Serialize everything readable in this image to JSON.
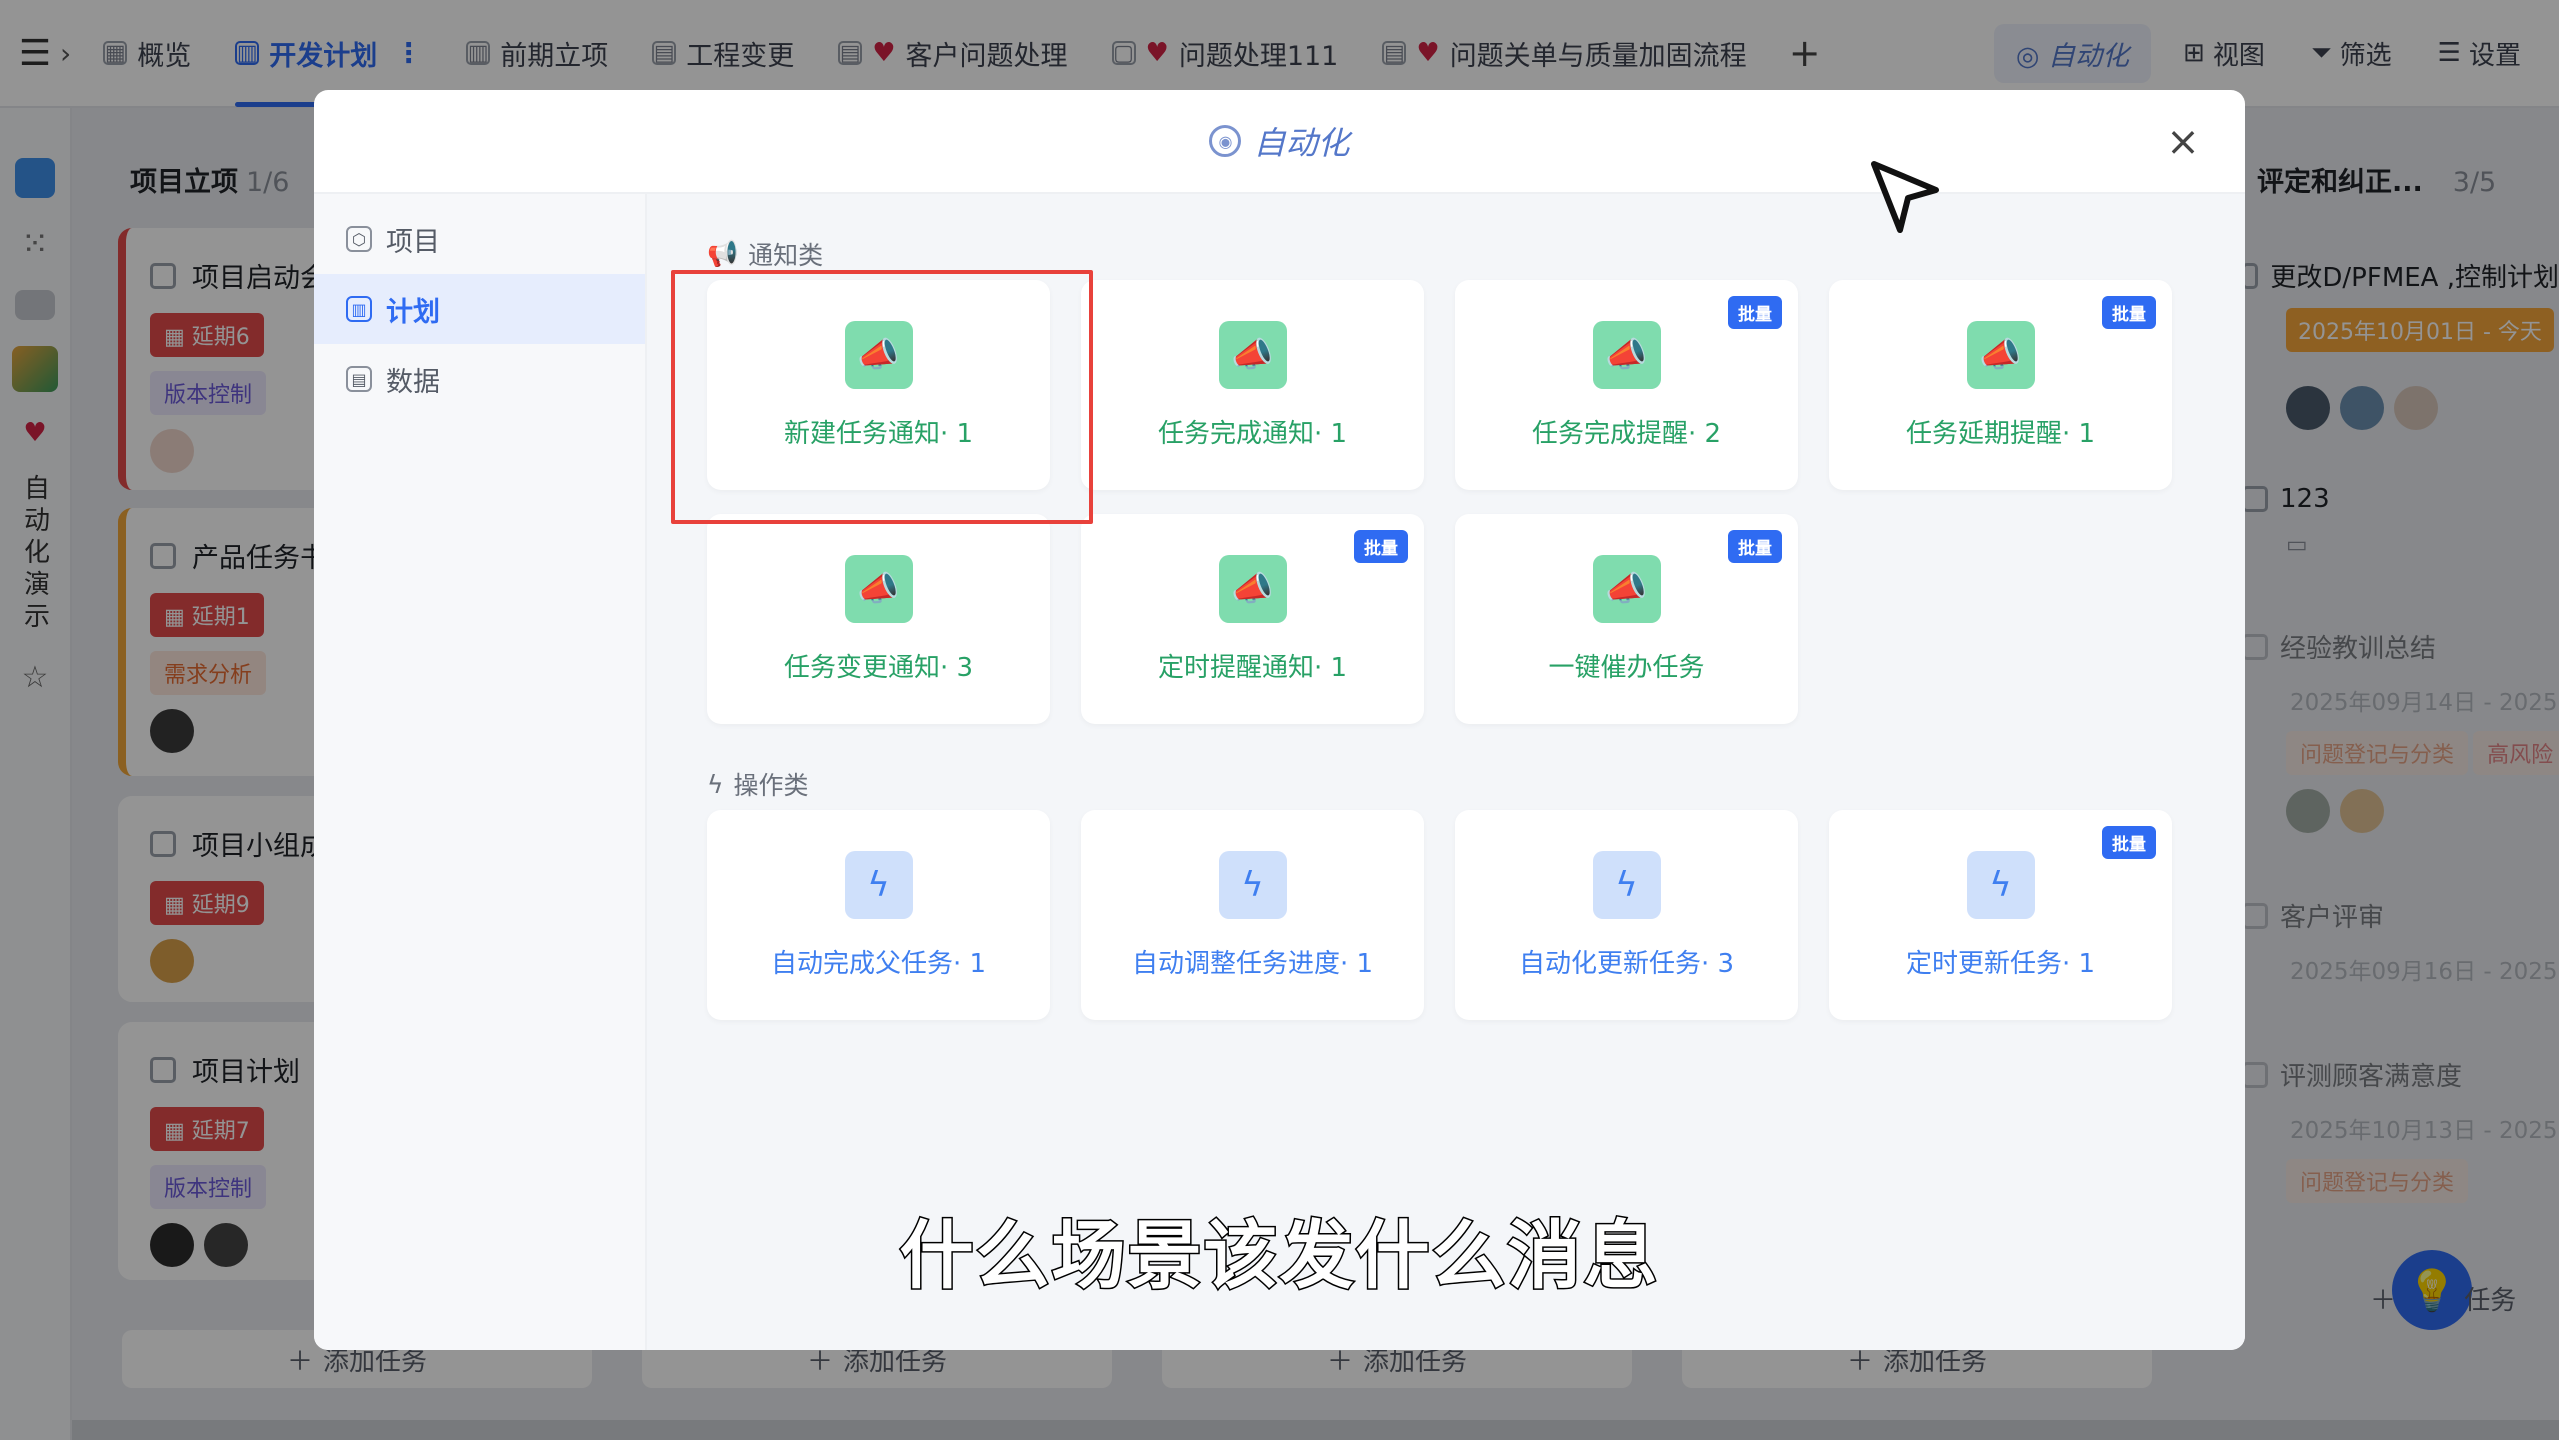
{
  "topbar": {
    "tabs": [
      {
        "label": "概览",
        "heart": false
      },
      {
        "label": "开发计划",
        "heart": false,
        "active": true
      },
      {
        "label": "前期立项",
        "heart": false
      },
      {
        "label": "工程变更",
        "heart": false
      },
      {
        "label": "客户问题处理",
        "heart": true
      },
      {
        "label": "问题处理111",
        "heart": true
      },
      {
        "label": "问题关单与质量加固流程",
        "heart": true
      }
    ],
    "more_glyph": "⋮",
    "add_tab": "+",
    "automation": "自动化",
    "view": "视图",
    "filter": "筛选",
    "settings": "设置"
  },
  "leftrail": {
    "vertical_label": "自动化演示"
  },
  "board": {
    "col1_title": "项目立项",
    "col1_count": "1/6",
    "cards": [
      {
        "title": "项目启动会",
        "delay": "延期6",
        "tag": "版本控制"
      },
      {
        "title": "产品任务书",
        "delay": "延期1",
        "tag": "需求分析"
      },
      {
        "title": "项目小组成",
        "delay": "延期9"
      },
      {
        "title": "项目计划",
        "delay": "延期7",
        "tag": "版本控制"
      }
    ],
    "add_task": "添加任务",
    "right_col_title": "、评定和纠正...",
    "right_col_count": "3/5",
    "right_items": [
      {
        "title": "更改D/PFMEA ,控制计划",
        "date": "2025年10月01日 - 今天"
      },
      {
        "title": "123"
      },
      {
        "title": "经验教训总结",
        "date": "2025年09月14日 - 2025",
        "tags": [
          "问题登记与分类",
          "高风险"
        ]
      },
      {
        "title": "客户评审",
        "date": "2025年09月16日 - 2025"
      },
      {
        "title": "评测顾客满意度",
        "date": "2025年10月13日 - 2025",
        "tags": [
          "问题登记与分类"
        ]
      }
    ],
    "right_add": "任务"
  },
  "modal": {
    "title": "自动化",
    "close": "×",
    "sidebar": [
      {
        "label": "项目",
        "icon": "cube-icon"
      },
      {
        "label": "计划",
        "icon": "board-icon",
        "active": true
      },
      {
        "label": "数据",
        "icon": "file-icon"
      }
    ],
    "notify_section": "通知类",
    "notify_cards": [
      {
        "label": "新建任务通知· 1",
        "badge": ""
      },
      {
        "label": "任务完成通知· 1",
        "badge": ""
      },
      {
        "label": "任务完成提醒· 2",
        "badge": "批量"
      },
      {
        "label": "任务延期提醒· 1",
        "badge": "批量"
      },
      {
        "label": "任务变更通知· 3",
        "badge": ""
      },
      {
        "label": "定时提醒通知· 1",
        "badge": "批量"
      },
      {
        "label": "一键催办任务",
        "badge": "批量"
      }
    ],
    "action_section": "操作类",
    "action_cards": [
      {
        "label": "自动完成父任务· 1",
        "badge": ""
      },
      {
        "label": "自动调整任务进度· 1",
        "badge": ""
      },
      {
        "label": "自动化更新任务· 3",
        "badge": ""
      },
      {
        "label": "定时更新任务· 1",
        "badge": "批量"
      }
    ]
  },
  "caption": "什么场景该发什么消息",
  "colors": {
    "accent": "#2f6bf2",
    "notify_green": "#28a166",
    "action_blue": "#3f7ff0",
    "highlight": "#e8413b"
  }
}
